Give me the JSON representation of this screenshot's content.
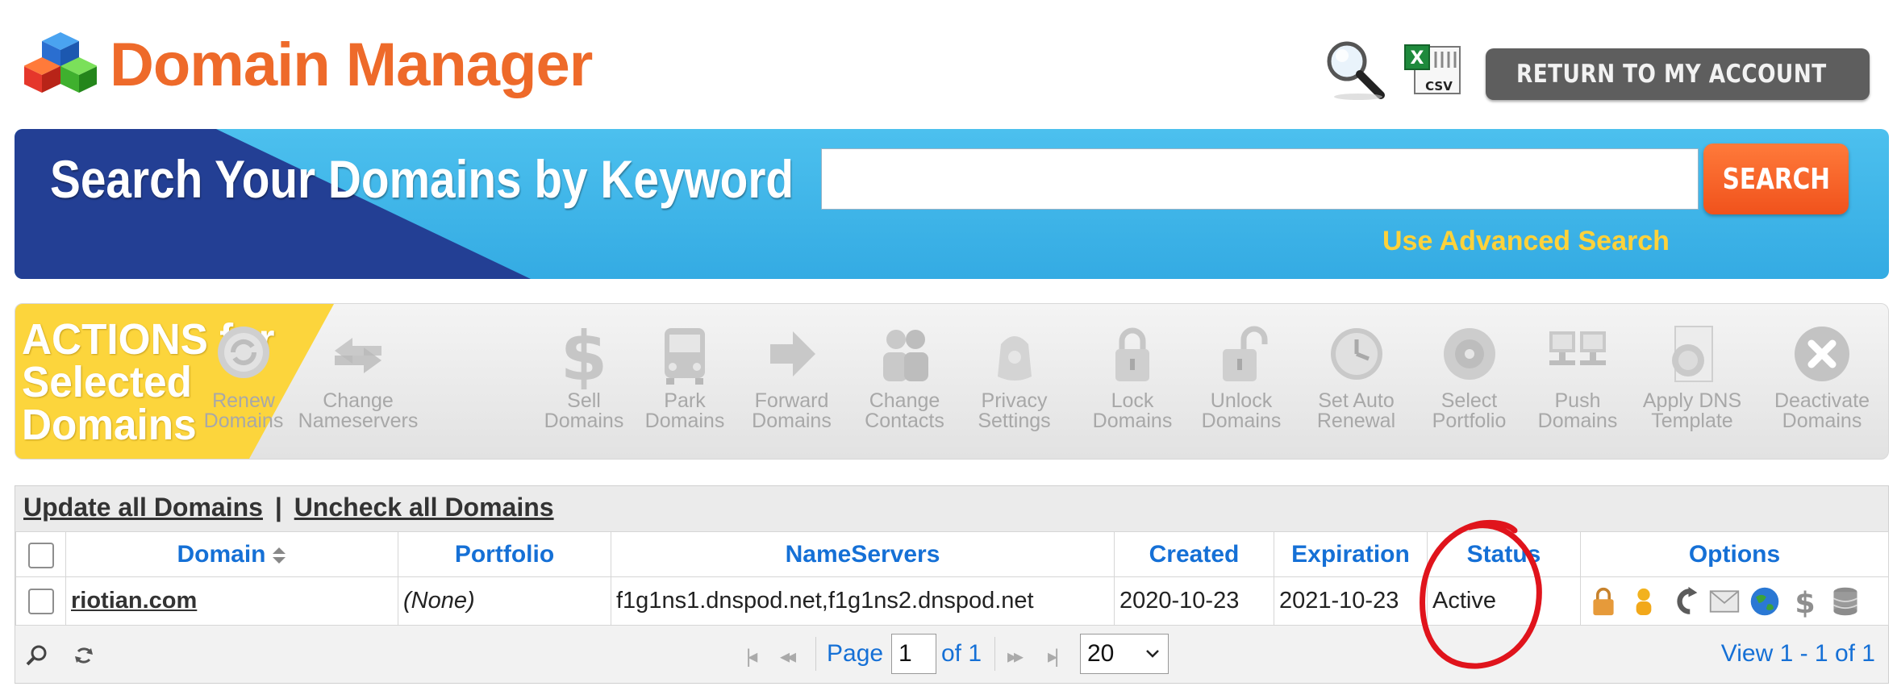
{
  "header": {
    "title": "Domain Manager",
    "logo_icon": "colored-cubes-logo",
    "search_icon": "magnifier-icon",
    "csv_icon": "excel-csv-icon",
    "csv_label": "CSV",
    "return_button": "RETURN TO MY ACCOUNT"
  },
  "search": {
    "title": "Search Your Domains by Keyword",
    "value": "",
    "button": "SEARCH",
    "advanced_link": "Use Advanced Search"
  },
  "actions": {
    "title_line1": "ACTIONS for",
    "title_line2": "Selected",
    "title_line3": "Domains",
    "items": [
      {
        "line1": "Renew",
        "line2": "Domains",
        "icon": "renew-icon"
      },
      {
        "line1": "Change",
        "line2": "Nameservers",
        "icon": "swap-arrows-icon"
      },
      {
        "line1": "Sell",
        "line2": "Domains",
        "icon": "dollar-icon"
      },
      {
        "line1": "Park",
        "line2": "Domains",
        "icon": "bus-icon"
      },
      {
        "line1": "Forward",
        "line2": "Domains",
        "icon": "forward-arrow-icon"
      },
      {
        "line1": "Change",
        "line2": "Contacts",
        "icon": "contacts-icon"
      },
      {
        "line1": "Privacy",
        "line2": "Settings",
        "icon": "privacy-icon"
      },
      {
        "line1": "Lock",
        "line2": "Domains",
        "icon": "lock-icon"
      },
      {
        "line1": "Unlock",
        "line2": "Domains",
        "icon": "unlock-icon"
      },
      {
        "line1": "Set Auto",
        "line2": "Renewal",
        "icon": "clock-icon"
      },
      {
        "line1": "Select",
        "line2": "Portfolio",
        "icon": "disc-icon"
      },
      {
        "line1": "Push",
        "line2": "Domains",
        "icon": "monitors-icon"
      },
      {
        "line1": "Apply DNS",
        "line2": "Template",
        "icon": "dns-template-icon"
      },
      {
        "line1": "Deactivate",
        "line2": "Domains",
        "icon": "deactivate-x-icon"
      }
    ]
  },
  "grid": {
    "update_all": "Update all Domains",
    "separator": "|",
    "uncheck_all": "Uncheck all Domains",
    "columns": [
      "Domain",
      "Portfolio",
      "NameServers",
      "Created",
      "Expiration",
      "Status",
      "Options"
    ],
    "rows": [
      {
        "domain": "riotian.com",
        "portfolio": "(None)",
        "nameservers": "f1g1ns1.dnspod.net,f1g1ns2.dnspod.net",
        "created": "2020-10-23",
        "expiration": "2021-10-23",
        "status": "Active",
        "options": [
          "lock-icon",
          "contact-person-icon",
          "forward-hook-icon",
          "email-icon",
          "globe-icon",
          "dollar-icon",
          "database-icon"
        ]
      }
    ],
    "pager": {
      "page_label": "Page",
      "page_value": "1",
      "of_label": "of 1",
      "page_size": "20",
      "view_label": "View 1 - 1 of 1"
    }
  },
  "colors": {
    "title_orange": "#ee6a2a",
    "banner_blue": "#34abe3",
    "banner_dark": "#233f94",
    "actions_yellow": "#fcd53c",
    "link_blue": "#1570d6",
    "advanced_yellow": "#ffd23a",
    "annotation_red": "#e0141c"
  }
}
